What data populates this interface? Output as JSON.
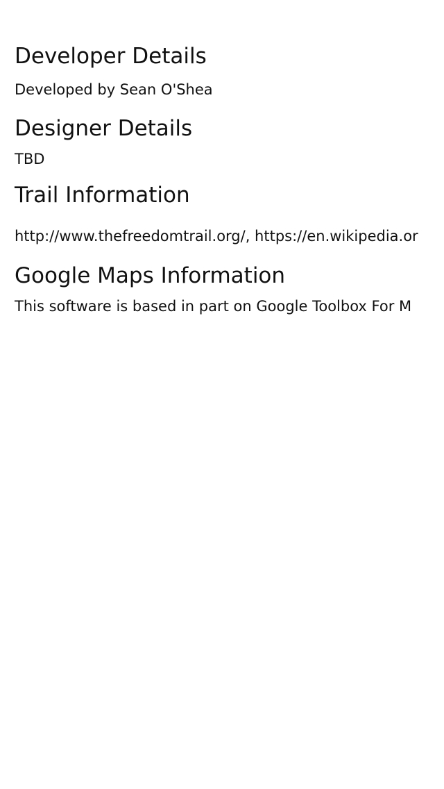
{
  "developer": {
    "heading": "Developer Details",
    "text": "Developed by Sean O'Shea"
  },
  "designer": {
    "heading": "Designer Details",
    "text": "TBD"
  },
  "trail": {
    "heading": "Trail Information",
    "text": "http://www.thefreedomtrail.org/, https://en.wikipedia.or"
  },
  "maps": {
    "heading": "Google Maps Information",
    "text": "This software is based in part on Google Toolbox For M"
  }
}
